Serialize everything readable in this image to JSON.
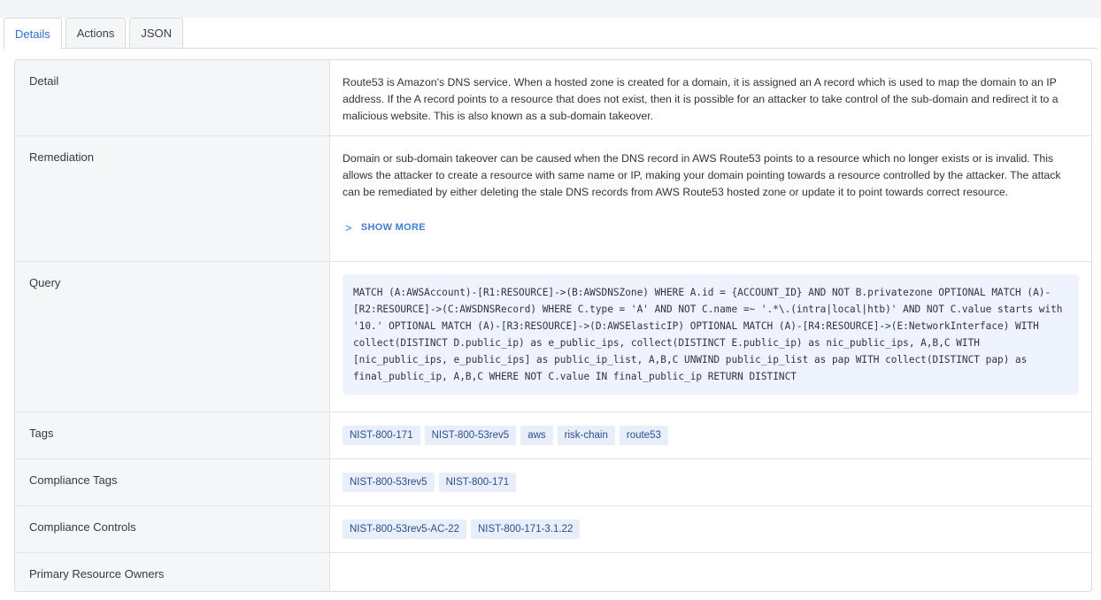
{
  "tabs": [
    {
      "label": "Details",
      "active": true
    },
    {
      "label": "Actions",
      "active": false
    },
    {
      "label": "JSON",
      "active": false
    }
  ],
  "detail": {
    "label": "Detail",
    "text": "Route53 is Amazon's DNS service. When a hosted zone is created for a domain, it is assigned an A record which is used to map the domain to an IP address. If the A record points to a resource that does not exist, then it is possible for an attacker to take control of the sub-domain and redirect it to a malicious website. This is also known as a sub-domain takeover."
  },
  "remediation": {
    "label": "Remediation",
    "text": "Domain or sub-domain takeover can be caused when the DNS record in AWS Route53 points to a resource which no longer exists or is invalid. This allows the attacker to create a resource with same name or IP, making your domain pointing towards a resource controlled by the attacker. The attack can be remediated by either deleting the stale DNS records from AWS Route53 hosted zone or update it to point towards correct resource.",
    "show_more_label": "SHOW MORE"
  },
  "query": {
    "label": "Query",
    "text": "MATCH (A:AWSAccount)-[R1:RESOURCE]->(B:AWSDNSZone) WHERE A.id = {ACCOUNT_ID} AND NOT B.privatezone OPTIONAL MATCH (A)-[R2:RESOURCE]->(C:AWSDNSRecord) WHERE C.type = 'A' AND NOT C.name =~ '.*\\.(intra|local|htb)' AND NOT C.value starts with '10.' OPTIONAL MATCH (A)-[R3:RESOURCE]->(D:AWSElasticIP) OPTIONAL MATCH (A)-[R4:RESOURCE]->(E:NetworkInterface) WITH collect(DISTINCT D.public_ip) as e_public_ips, collect(DISTINCT E.public_ip) as nic_public_ips, A,B,C WITH [nic_public_ips, e_public_ips] as public_ip_list, A,B,C UNWIND public_ip_list as pap WITH collect(DISTINCT pap) as final_public_ip, A,B,C WHERE NOT C.value IN final_public_ip RETURN DISTINCT"
  },
  "tags": {
    "label": "Tags",
    "items": [
      "NIST-800-171",
      "NIST-800-53rev5",
      "aws",
      "risk-chain",
      "route53"
    ]
  },
  "compliance_tags": {
    "label": "Compliance Tags",
    "items": [
      "NIST-800-53rev5",
      "NIST-800-171"
    ]
  },
  "compliance_controls": {
    "label": "Compliance Controls",
    "items": [
      "NIST-800-53rev5-AC-22",
      "NIST-800-171-3.1.22"
    ]
  },
  "primary_resource_owners": {
    "label": "Primary Resource Owners",
    "text": ""
  },
  "icons": {
    "show_more": "chevron-right-icon"
  }
}
